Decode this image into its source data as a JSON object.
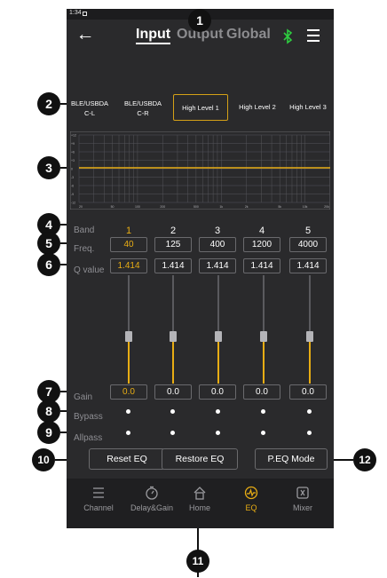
{
  "status": {
    "time": "1:34"
  },
  "header": {
    "tabs": [
      {
        "label": "Input",
        "active": true
      },
      {
        "label": "Output",
        "active": false
      },
      {
        "label": "Global",
        "active": false
      }
    ],
    "bluetooth_icon": "bluetooth-icon",
    "menu_icon": "menu-icon",
    "back_icon": "back-arrow-icon"
  },
  "channels": [
    {
      "line1": "BLE/USBDA",
      "line2": "C-L"
    },
    {
      "line1": "BLE/USBDA",
      "line2": "C-R"
    },
    {
      "line1": "High Level 1",
      "line2": ""
    },
    {
      "line1": "High Level 2",
      "line2": ""
    },
    {
      "line1": "High Level 3",
      "line2": ""
    }
  ],
  "graph": {
    "x_ticks": [
      "20",
      "50",
      "100",
      "200",
      "500",
      "1k",
      "2k",
      "5k",
      "10k",
      "20k"
    ],
    "y_ticks": [
      "+12",
      "+9",
      "+6",
      "+3",
      "0",
      "-3",
      "-6",
      "-9",
      "-12"
    ],
    "curve_color": "#e8ad14"
  },
  "eq": {
    "labels": {
      "band": "Band",
      "freq": "Freq.",
      "q": "Q value",
      "gain": "Gain",
      "bypass": "Bypass",
      "allpass": "Allpass"
    },
    "selected_band": 1,
    "bands": [
      {
        "num": "1",
        "freq": "40",
        "q": "1.414",
        "gain": "0.0"
      },
      {
        "num": "2",
        "freq": "125",
        "q": "1.414",
        "gain": "0.0"
      },
      {
        "num": "3",
        "freq": "400",
        "q": "1.414",
        "gain": "0.0"
      },
      {
        "num": "4",
        "freq": "1200",
        "q": "1.414",
        "gain": "0.0"
      },
      {
        "num": "5",
        "freq": "4000",
        "q": "1.414",
        "gain": "0.0"
      }
    ]
  },
  "buttons": {
    "reset": "Reset EQ",
    "restore": "Restore EQ",
    "peq": "P.EQ Mode"
  },
  "nav": [
    {
      "label": "Channel",
      "icon": "list-icon",
      "active": false
    },
    {
      "label": "Delay&Gain",
      "icon": "timer-icon",
      "active": false
    },
    {
      "label": "Home",
      "icon": "home-icon",
      "active": false
    },
    {
      "label": "EQ",
      "icon": "eq-icon",
      "active": true
    },
    {
      "label": "Mixer",
      "icon": "mixer-icon",
      "active": false
    }
  ],
  "callouts": [
    "1",
    "2",
    "3",
    "4",
    "5",
    "6",
    "7",
    "8",
    "9",
    "10",
    "11",
    "12"
  ],
  "colors": {
    "accent": "#e8ad14",
    "bluetooth": "#2ecc40",
    "background": "#2a2a2c"
  }
}
